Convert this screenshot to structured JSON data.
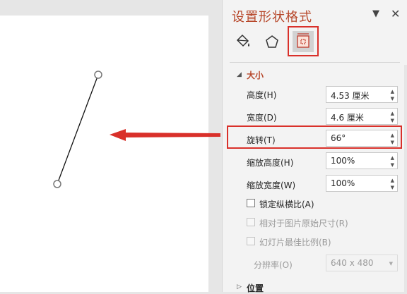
{
  "pane": {
    "title": "设置形状格式",
    "dropdown_icon": "chevron-down-icon",
    "close_icon": "close-icon"
  },
  "tabs": [
    {
      "name": "fill-line",
      "icon": "paint-bucket-icon",
      "active": false
    },
    {
      "name": "effects",
      "icon": "pentagon-icon",
      "active": false
    },
    {
      "name": "size-properties",
      "icon": "size-icon",
      "active": true
    }
  ],
  "size_section": {
    "title": "大小",
    "fields": [
      {
        "label": "高度(H)",
        "value": "4.53 厘米"
      },
      {
        "label": "宽度(D)",
        "value": "4.6 厘米"
      },
      {
        "label": "旋转(T)",
        "value": "66°"
      },
      {
        "label": "缩放高度(H)",
        "value": "100%"
      },
      {
        "label": "缩放宽度(W)",
        "value": "100%"
      }
    ],
    "checkboxes": [
      {
        "label": "锁定纵横比(A)",
        "checked": false,
        "disabled": false
      },
      {
        "label": "相对于图片原始尺寸(R)",
        "checked": false,
        "disabled": true
      },
      {
        "label": "幻灯片最佳比例(B)",
        "checked": false,
        "disabled": true
      }
    ],
    "resolution": {
      "label": "分辨率(O)",
      "value": "640 x 480"
    }
  },
  "position_section": {
    "title": "位置"
  },
  "colors": {
    "accent": "#b7472a",
    "highlight": "#d9302a"
  }
}
